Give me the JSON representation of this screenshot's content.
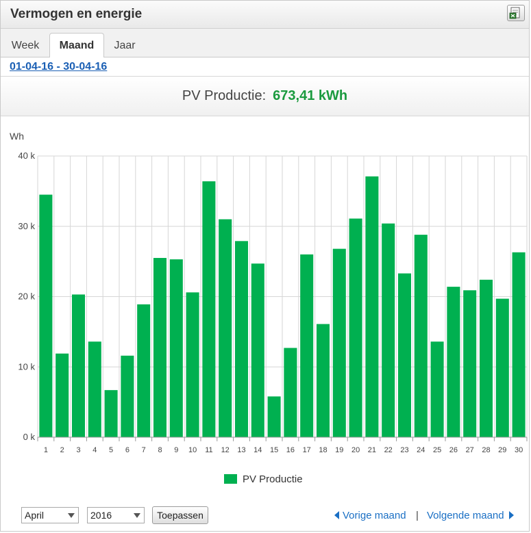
{
  "header": {
    "title": "Vermogen en energie",
    "export_icon": "export-document-icon"
  },
  "tabs": [
    {
      "label": "Week",
      "active": false
    },
    {
      "label": "Maand",
      "active": true
    },
    {
      "label": "Jaar",
      "active": false
    }
  ],
  "period": {
    "range": "01-04-16 - 30-04-16"
  },
  "summary": {
    "label": "PV Productie:",
    "value": "673,41 kWh"
  },
  "colors": {
    "bar": "#00b050",
    "value": "#1a9a3e",
    "link": "#1a6fc4"
  },
  "chart_data": {
    "type": "bar",
    "ylabel": "Wh",
    "ylim": [
      0,
      40000
    ],
    "yticks": [
      0,
      10000,
      20000,
      30000,
      40000
    ],
    "ytick_labels": [
      "0 k",
      "10 k",
      "20 k",
      "30 k",
      "40 k"
    ],
    "grid": true,
    "legend_position": "bottom",
    "categories": [
      "1",
      "2",
      "3",
      "4",
      "5",
      "6",
      "7",
      "8",
      "9",
      "10",
      "11",
      "12",
      "13",
      "14",
      "15",
      "16",
      "17",
      "18",
      "19",
      "20",
      "21",
      "22",
      "23",
      "24",
      "25",
      "26",
      "27",
      "28",
      "29",
      "30"
    ],
    "series": [
      {
        "name": "PV Productie",
        "color": "#00b050",
        "values": [
          34500,
          11900,
          20300,
          13600,
          6700,
          11600,
          18900,
          25500,
          25300,
          20600,
          36400,
          31000,
          27900,
          24700,
          5800,
          12700,
          26000,
          16100,
          26800,
          31100,
          37100,
          30400,
          23300,
          28800,
          13600,
          21400,
          20900,
          22400,
          19700,
          26300
        ]
      }
    ]
  },
  "controls": {
    "month": "April",
    "year": "2016",
    "apply": "Toepassen",
    "prev": "Vorige maand",
    "separator": "|",
    "next": "Volgende maand"
  }
}
